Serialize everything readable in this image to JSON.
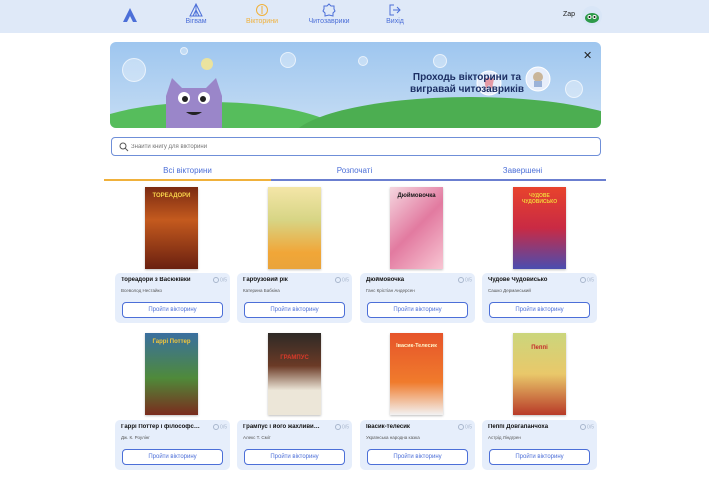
{
  "nav": {
    "items": [
      {
        "label": "Вігвам",
        "icon": "tent-icon"
      },
      {
        "label": "Вікторини",
        "icon": "quiz-icon"
      },
      {
        "label": "Читозаврики",
        "icon": "badge-icon"
      },
      {
        "label": "Вихід",
        "icon": "logout-icon"
      }
    ],
    "user_name": "Zap"
  },
  "banner": {
    "line1": "Проходь вікторини та",
    "line2": "вигравай читозавриків"
  },
  "search": {
    "placeholder": "Знайти книгу для вікторини"
  },
  "tabs": [
    {
      "label": "Всі вікторини"
    },
    {
      "label": "Розпочаті"
    },
    {
      "label": "Завершені"
    }
  ],
  "colors": {
    "accent": "#4c6fd8",
    "active_nav": "#f0b13b",
    "card_bg": "#e6eefb",
    "nav_bg": "#dfe9f8"
  },
  "cards": [
    {
      "title": "Тореадори з Васюківки",
      "author": "Всеволод Нестайко",
      "score": "0/5",
      "button": "Пройти вікторину",
      "cover_title": "ТОРЕАДОРИ"
    },
    {
      "title": "Гарбузовий рік",
      "author": "Катерина Бабкіна",
      "score": "0/5",
      "button": "Пройти вікторину",
      "cover_title": ""
    },
    {
      "title": "Дюймовочка",
      "author": "Ганс Крістіан Андерсен",
      "score": "0/5",
      "button": "Пройти вікторину",
      "cover_title": "Дюймовочка"
    },
    {
      "title": "Чудове Чудовисько",
      "author": "Сашко Дерманський",
      "score": "0/5",
      "button": "Пройти вікторину",
      "cover_title": "ЧУДОВЕ ЧУДОВИСЬКО"
    },
    {
      "title": "Гаррі Поттер і філософсь...",
      "author": "Дж. К. Роулінг",
      "score": "0/5",
      "button": "Пройти вікторину",
      "cover_title": "Гаррі Поттер"
    },
    {
      "title": "Грампус і його жахливий ...",
      "author": "Алекс Т. Сміт",
      "score": "0/5",
      "button": "Пройти вікторину",
      "cover_title": "ГРАМПУС"
    },
    {
      "title": "Івасик-телесик",
      "author": "Українська народна казка",
      "score": "0/5",
      "button": "Пройти вікторину",
      "cover_title": "Івасик-Телесик"
    },
    {
      "title": "Пеппі Довгапанчоха",
      "author": "Астрід Ліндгрен",
      "score": "0/5",
      "button": "Пройти вікторину",
      "cover_title": "Пеппі"
    }
  ]
}
